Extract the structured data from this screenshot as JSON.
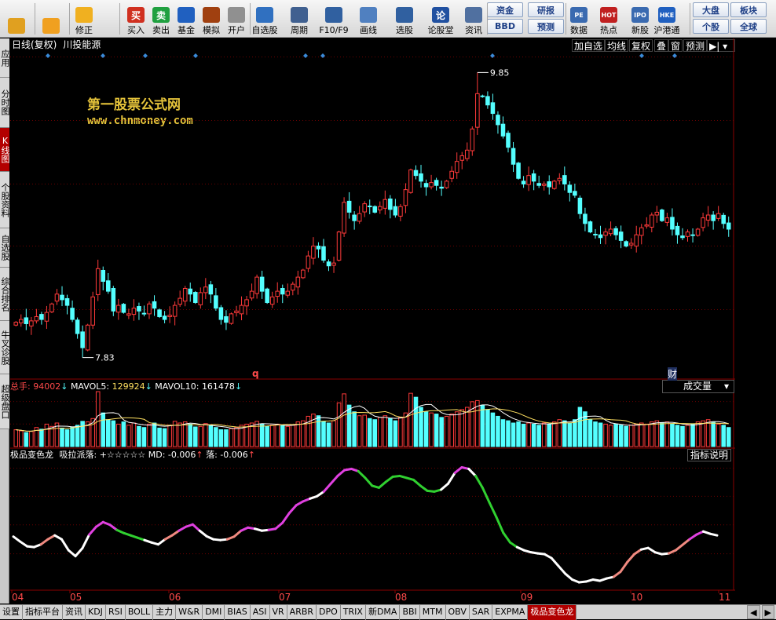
{
  "toolbar": {
    "items": [
      {
        "label": "",
        "icon": "grid-icon"
      },
      {
        "label": "",
        "icon": "back-arrow-icon"
      },
      {
        "label": "修正",
        "icon": "refresh-icon"
      },
      {
        "label": "买入",
        "icon": "buy-icon",
        "glyph": "买"
      },
      {
        "label": "卖出",
        "icon": "sell-icon",
        "glyph": "卖"
      },
      {
        "label": "基金",
        "icon": "fund-icon"
      },
      {
        "label": "模拟",
        "icon": "hammer-icon"
      },
      {
        "label": "开户",
        "icon": "lock-icon"
      },
      {
        "label": "自选股",
        "icon": "star-icon"
      },
      {
        "label": "周期",
        "icon": "clock-icon"
      },
      {
        "label": "F10/F9",
        "icon": "f10-icon"
      },
      {
        "label": "画线",
        "icon": "pen-icon"
      },
      {
        "label": "选股",
        "icon": "screen-icon"
      },
      {
        "label": "论股堂",
        "icon": "forum-icon",
        "glyph": "论"
      },
      {
        "label": "资讯",
        "icon": "news-icon"
      },
      {
        "label": "数据",
        "icon": "pe-icon",
        "glyph": "PE"
      },
      {
        "label": "热点",
        "icon": "hot-icon",
        "glyph": "HOT"
      },
      {
        "label": "新股",
        "icon": "ipo-icon",
        "glyph": "IPO"
      },
      {
        "label": "沪港通",
        "icon": "hke-icon",
        "glyph": "HKE"
      }
    ],
    "pairs": [
      {
        "top": "资金",
        "bottom": "BBD"
      },
      {
        "top": "研报",
        "bottom": "预测"
      },
      {
        "top": "大盘",
        "bottom": "个股"
      },
      {
        "top": "板块",
        "bottom": "全球"
      }
    ]
  },
  "sidebar": {
    "tabs": [
      "应用",
      "分时图",
      "K线图",
      "个股资料",
      "自选股",
      "综合排名",
      "牛叉诊股",
      "超级盘口"
    ],
    "active": 2
  },
  "chart_header": {
    "period": "日线(复权)",
    "stock": "川投能源",
    "buttons": [
      "加自选",
      "均线",
      "复权",
      "叠",
      "窗",
      "预测"
    ],
    "nav_glyph": "▶|"
  },
  "watermark": {
    "line1": "第一股票公式网",
    "line2": "www.chnmoney.com"
  },
  "volume_header": {
    "total_label": "总手:",
    "total_value": "94002",
    "ma5_label": "MAVOL5:",
    "ma5_value": "129924",
    "ma10_label": "MAVOL10:",
    "ma10_value": "161478",
    "arrow": "↓",
    "selector": "成交量"
  },
  "indicator_header": {
    "name": "极品变色龙",
    "line": "吸拉派落: +☆☆☆☆☆",
    "md_label": "MD:",
    "md_value": "-0.006",
    "luo_label": "落:",
    "luo_value": "-0.006",
    "up_arrow": "↑",
    "explain_btn": "指标说明"
  },
  "markers": {
    "q": "q",
    "cai": "财"
  },
  "colors": {
    "up": "#ff3a3a",
    "down": "#54ffff",
    "grid": "#6a0000",
    "magenta": "#e040e0",
    "green": "#30d030",
    "salmon": "#f08a80"
  },
  "chart_data": [
    {
      "type": "candlestick",
      "title": "川投能源 日线(复权)",
      "ylim": [
        7.7,
        9.98
      ],
      "y_ticks": [
        "9.96",
        "9.51",
        "9.06",
        "8.62",
        "8.17"
      ],
      "annotations": [
        {
          "label": "9.85",
          "type": "high"
        },
        {
          "label": "7.83",
          "type": "low"
        }
      ],
      "x_ticks": [
        "04",
        "05",
        "06",
        "07",
        "08",
        "09",
        "10",
        "11"
      ],
      "closes": [
        8.08,
        8.1,
        8.07,
        8.09,
        8.12,
        8.1,
        8.15,
        8.21,
        8.28,
        8.24,
        8.2,
        8.1,
        8.0,
        7.9,
        8.06,
        8.26,
        8.46,
        8.37,
        8.3,
        8.16,
        8.2,
        8.15,
        8.14,
        8.18,
        8.16,
        8.14,
        8.21,
        8.18,
        8.12,
        8.1,
        8.13,
        8.2,
        8.25,
        8.32,
        8.28,
        8.22,
        8.29,
        8.33,
        8.28,
        8.18,
        8.1,
        8.08,
        8.14,
        8.16,
        8.2,
        8.24,
        8.3,
        8.4,
        8.3,
        8.22,
        8.26,
        8.3,
        8.28,
        8.3,
        8.35,
        8.4,
        8.45,
        8.55,
        8.62,
        8.6,
        8.52,
        8.48,
        8.5,
        8.72,
        8.93,
        8.86,
        8.8,
        8.85,
        8.92,
        8.9,
        8.86,
        8.9,
        8.95,
        8.88,
        8.84,
        8.9,
        9.02,
        9.16,
        9.12,
        9.08,
        9.04,
        9.07,
        9.05,
        9.03,
        9.08,
        9.15,
        9.22,
        9.26,
        9.3,
        9.45,
        9.7,
        9.68,
        9.62,
        9.56,
        9.48,
        9.4,
        9.32,
        9.2,
        9.1,
        9.06,
        9.12,
        9.08,
        9.05,
        9.06,
        9.04,
        9.08,
        9.1,
        9.06,
        9.0,
        8.98,
        8.85,
        8.78,
        8.72,
        8.7,
        8.68,
        8.72,
        8.74,
        8.7,
        8.66,
        8.62,
        8.64,
        8.7,
        8.75,
        8.77,
        8.84,
        8.86,
        8.8,
        8.82,
        8.74,
        8.7,
        8.68,
        8.72,
        8.7,
        8.74,
        8.82,
        8.84,
        8.8,
        8.85,
        8.78,
        8.74
      ],
      "max_idx": 90,
      "min_idx": 13
    },
    {
      "type": "bar",
      "title": "成交量",
      "y_ticks": [
        "80852",
        "40426"
      ],
      "unit": "X10",
      "values": [
        30,
        28,
        25,
        27,
        34,
        31,
        40,
        36,
        42,
        33,
        30,
        35,
        38,
        45,
        44,
        50,
        98,
        60,
        48,
        46,
        40,
        44,
        38,
        42,
        36,
        34,
        40,
        42,
        33,
        32,
        38,
        45,
        42,
        44,
        40,
        35,
        36,
        41,
        38,
        34,
        30,
        30,
        32,
        34,
        38,
        40,
        42,
        45,
        40,
        36,
        38,
        40,
        38,
        36,
        38,
        44,
        46,
        54,
        58,
        55,
        45,
        42,
        46,
        78,
        94,
        74,
        62,
        55,
        56,
        50,
        48,
        52,
        55,
        50,
        46,
        52,
        60,
        95,
        88,
        70,
        62,
        60,
        58,
        52,
        54,
        58,
        62,
        66,
        70,
        80,
        82,
        74,
        66,
        60,
        54,
        48,
        46,
        42,
        44,
        40,
        42,
        40,
        38,
        42,
        40,
        44,
        48,
        46,
        42,
        48,
        70,
        62,
        48,
        44,
        42,
        40,
        38,
        40,
        38,
        36,
        38,
        40,
        42,
        40,
        44,
        46,
        42,
        44,
        40,
        38,
        36,
        38,
        40,
        44,
        46,
        48,
        44,
        40,
        38,
        34
      ]
    },
    {
      "type": "line",
      "title": "极品变色龙",
      "ylim": [
        -0.14,
        0.185
      ],
      "y_ticks": [
        "+0.170",
        "+0.098",
        "+0.025",
        "-0.049"
      ],
      "values": [
        -0.005,
        -0.018,
        -0.03,
        -0.032,
        -0.025,
        -0.012,
        -0.002,
        -0.012,
        -0.04,
        -0.055,
        -0.035,
        0.0,
        0.02,
        0.032,
        0.025,
        0.012,
        0.004,
        -0.002,
        -0.008,
        -0.014,
        -0.02,
        -0.025,
        -0.012,
        -0.002,
        0.01,
        0.02,
        0.026,
        0.01,
        -0.004,
        -0.012,
        -0.014,
        -0.012,
        -0.005,
        0.01,
        0.018,
        0.015,
        0.01,
        0.012,
        0.015,
        0.03,
        0.055,
        0.075,
        0.085,
        0.092,
        0.098,
        0.11,
        0.13,
        0.15,
        0.165,
        0.168,
        0.162,
        0.145,
        0.125,
        0.12,
        0.135,
        0.148,
        0.15,
        0.145,
        0.14,
        0.125,
        0.112,
        0.11,
        0.115,
        0.13,
        0.158,
        0.172,
        0.168,
        0.15,
        0.12,
        0.082,
        0.045,
        0.005,
        -0.02,
        -0.032,
        -0.04,
        -0.045,
        -0.048,
        -0.05,
        -0.06,
        -0.08,
        -0.1,
        -0.115,
        -0.122,
        -0.12,
        -0.115,
        -0.118,
        -0.112,
        -0.108,
        -0.095,
        -0.07,
        -0.05,
        -0.038,
        -0.034,
        -0.045,
        -0.05,
        -0.048,
        -0.04,
        -0.026,
        -0.012,
        0.0,
        0.008,
        0.002,
        -0.002
      ],
      "segment_colors": [
        "white",
        "white",
        "white",
        "white",
        "salmon",
        "salmon",
        "white",
        "white",
        "white",
        "white",
        "white",
        "magenta",
        "magenta",
        "magenta",
        "magenta",
        "green",
        "green",
        "green",
        "green",
        "white",
        "white",
        "white",
        "salmon",
        "salmon",
        "magenta",
        "magenta",
        "magenta",
        "white",
        "white",
        "white",
        "white",
        "salmon",
        "salmon",
        "magenta",
        "magenta",
        "white",
        "white",
        "magenta",
        "magenta",
        "magenta",
        "magenta",
        "magenta",
        "magenta",
        "white",
        "white",
        "magenta",
        "magenta",
        "magenta",
        "magenta",
        "magenta",
        "green",
        "green",
        "green",
        "green",
        "green",
        "green",
        "green",
        "green",
        "green",
        "green",
        "green",
        "green",
        "white",
        "white",
        "magenta",
        "magenta",
        "white",
        "green",
        "green",
        "green",
        "green",
        "green",
        "green",
        "white",
        "white",
        "white",
        "white",
        "white",
        "white",
        "white",
        "white",
        "white",
        "white",
        "white",
        "white",
        "white",
        "white",
        "salmon",
        "salmon",
        "salmon",
        "salmon",
        "white",
        "white",
        "white",
        "white",
        "salmon",
        "salmon",
        "salmon",
        "magenta",
        "magenta",
        "white",
        "white",
        "white"
      ]
    }
  ],
  "bottom_tabs": [
    "设置",
    "指标平台",
    "资讯",
    "KDJ",
    "RSI",
    "BOLL",
    "主力",
    "W&R",
    "DMI",
    "BIAS",
    "ASI",
    "VR",
    "ARBR",
    "DPO",
    "TRIX",
    "新DMA",
    "BBI",
    "MTM",
    "OBV",
    "SAR",
    "EXPMA",
    "极品变色龙"
  ],
  "bottom_active": 21
}
